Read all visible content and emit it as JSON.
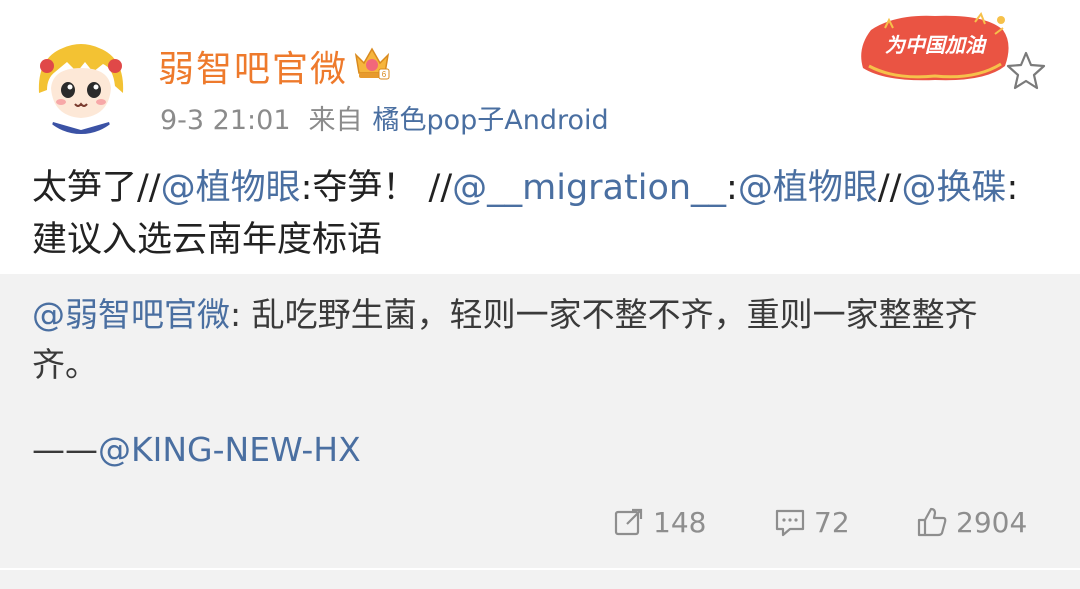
{
  "author": {
    "name": "弱智吧官微",
    "time": "9-3 21:01",
    "via": "来自",
    "source": "橘色pop子Android"
  },
  "badge": {
    "text": "为中国加油"
  },
  "post": {
    "segments": [
      {
        "text": "太笋了//",
        "mention": false
      },
      {
        "text": "@植物眼",
        "mention": true
      },
      {
        "text": ":夺笋！ //",
        "mention": false
      },
      {
        "text": "@__migration__",
        "mention": true
      },
      {
        "text": ":",
        "mention": false
      },
      {
        "text": "@植物眼",
        "mention": true
      },
      {
        "text": "//",
        "mention": false
      },
      {
        "text": "@换碟",
        "mention": true
      },
      {
        "text": ":建议入选云南年度标语",
        "mention": false
      }
    ]
  },
  "quoted": {
    "mention": "@弱智吧官微",
    "text": ": 乱吃野生菌，轻则一家不整不齐，重则一家整整齐齐。",
    "signature_dash": "——",
    "signature_mention": "@KING-NEW-HX"
  },
  "stats": {
    "reposts": "148",
    "comments": "72",
    "likes": "2904"
  },
  "colors": {
    "author_name": "#ee7a2c",
    "mention": "#4a6fa1",
    "quote_bg": "#f2f2f2",
    "badge_red": "#e8412f"
  },
  "icons": [
    "crown-icon",
    "badge-icon",
    "star-icon",
    "repost-icon",
    "comment-icon",
    "like-icon"
  ]
}
